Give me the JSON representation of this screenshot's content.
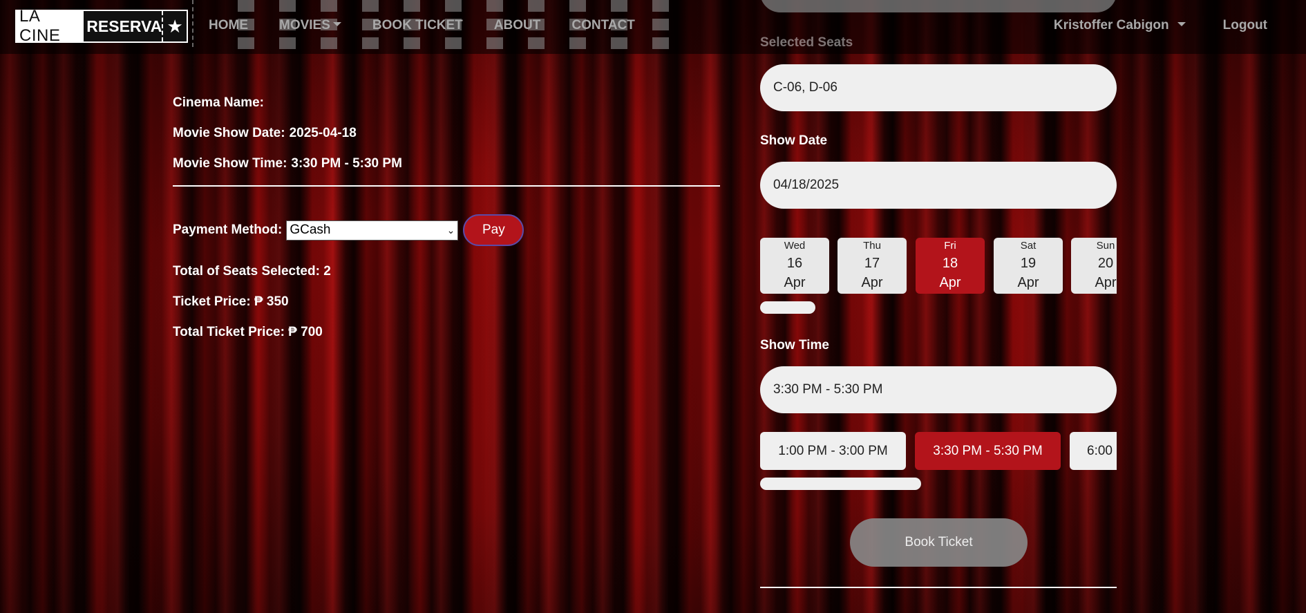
{
  "navbar": {
    "logo_left": "LA CINE",
    "logo_right": "RESERVA",
    "logo_star": "★",
    "links": [
      {
        "label": "HOME"
      },
      {
        "label": "MOVIES",
        "dropdown": true
      },
      {
        "label": "BOOK TICKET"
      },
      {
        "label": "ABOUT"
      },
      {
        "label": "CONTACT"
      }
    ],
    "user_name": "Kristoffer Cabigon",
    "logout": "Logout"
  },
  "summary": {
    "cinema_name_label": "Cinema Name:",
    "cinema_name_value": "",
    "show_date_label": "Movie Show Date:",
    "show_date_value": "2025-04-18",
    "show_time_label": "Movie Show Time:",
    "show_time_value": "3:30 PM - 5:30 PM",
    "payment_label": "Payment Method:",
    "payment_selected": "GCash",
    "pay_button": "Pay",
    "total_seats": "Total of Seats Selected: 2",
    "ticket_price": "Ticket Price: ₱ 350",
    "total_price": "Total Ticket Price: ₱ 700"
  },
  "booking": {
    "selected_seats_label": "Selected Seats",
    "selected_seats_value": "C-06, D-06",
    "show_date_label": "Show Date",
    "show_date_value": "04/18/2025",
    "dates": [
      {
        "dow": "Wed",
        "day": "16",
        "mon": "Apr",
        "active": false
      },
      {
        "dow": "Thu",
        "day": "17",
        "mon": "Apr",
        "active": false
      },
      {
        "dow": "Fri",
        "day": "18",
        "mon": "Apr",
        "active": true
      },
      {
        "dow": "Sat",
        "day": "19",
        "mon": "Apr",
        "active": false
      },
      {
        "dow": "Sun",
        "day": "20",
        "mon": "Apr",
        "active": false
      }
    ],
    "show_time_label": "Show Time",
    "show_time_value": "3:30 PM - 5:30 PM",
    "times": [
      {
        "label": "1:00 PM - 3:00 PM",
        "active": false
      },
      {
        "label": "3:30 PM - 5:30 PM",
        "active": true
      },
      {
        "label": "6:00",
        "active": false
      }
    ],
    "book_button": "Book Ticket"
  },
  "colors": {
    "accent_red": "#b3141b",
    "nav_text": "#a9a9a9",
    "field_bg": "#efefef"
  }
}
